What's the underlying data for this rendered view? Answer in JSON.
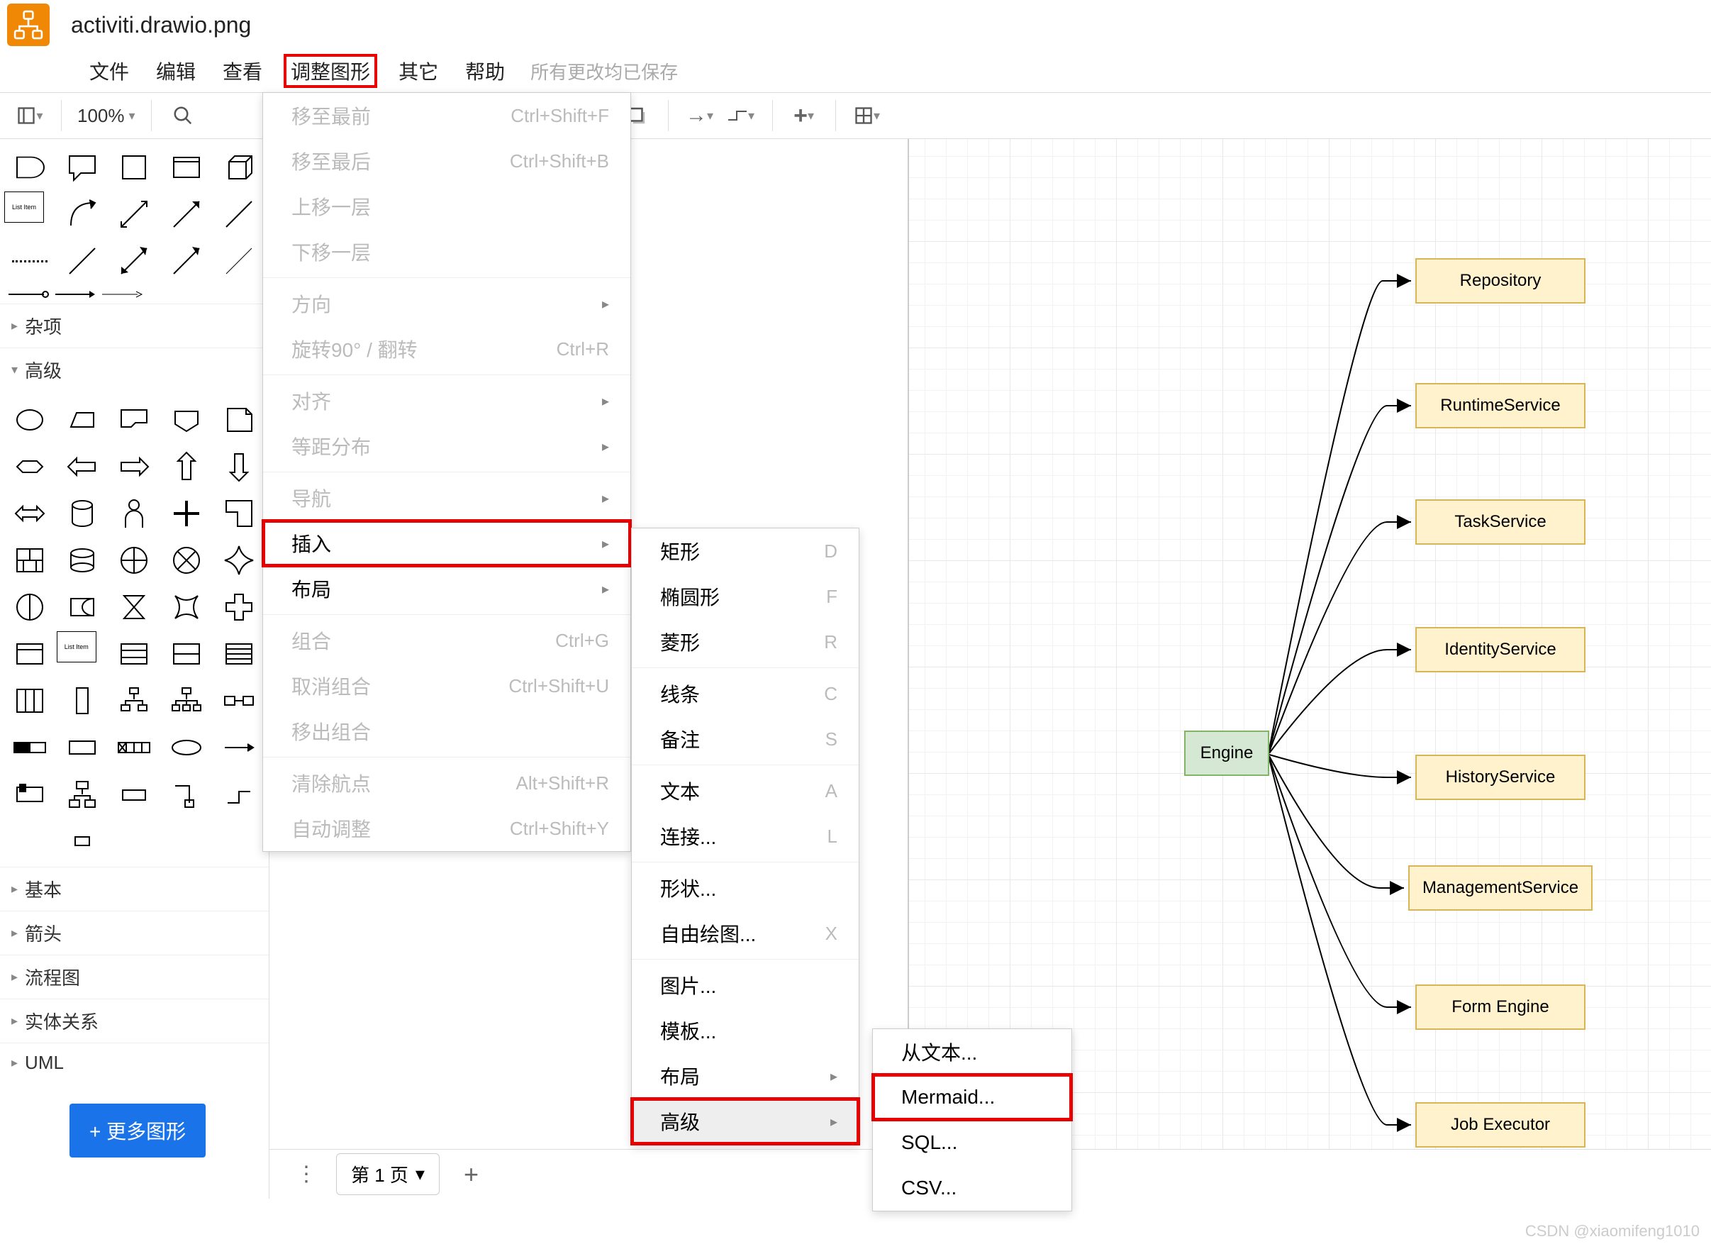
{
  "file": {
    "name": "activiti.drawio.png"
  },
  "menubar": {
    "items": [
      "文件",
      "编辑",
      "查看",
      "调整图形",
      "其它",
      "帮助"
    ],
    "saved": "所有更改均已保存"
  },
  "toolbar": {
    "zoom": "100%"
  },
  "sidebar": {
    "cats": [
      "杂项",
      "高级",
      "基本",
      "箭头",
      "流程图",
      "实体关系",
      "UML"
    ],
    "more": "+ 更多图形",
    "list_label": "List Item"
  },
  "dropdown1": {
    "toFront": {
      "label": "移至最前",
      "sc": "Ctrl+Shift+F"
    },
    "toBack": {
      "label": "移至最后",
      "sc": "Ctrl+Shift+B"
    },
    "up": {
      "label": "上移一层",
      "sc": ""
    },
    "down": {
      "label": "下移一层",
      "sc": ""
    },
    "direction": {
      "label": "方向"
    },
    "rotate": {
      "label": "旋转90° / 翻转",
      "sc": "Ctrl+R"
    },
    "align": {
      "label": "对齐"
    },
    "distribute": {
      "label": "等距分布"
    },
    "nav": {
      "label": "导航"
    },
    "insert": {
      "label": "插入"
    },
    "layout": {
      "label": "布局"
    },
    "group": {
      "label": "组合",
      "sc": "Ctrl+G"
    },
    "ungroup": {
      "label": "取消组合",
      "sc": "Ctrl+Shift+U"
    },
    "moveout": {
      "label": "移出组合"
    },
    "clearwp": {
      "label": "清除航点",
      "sc": "Alt+Shift+R"
    },
    "autofit": {
      "label": "自动调整",
      "sc": "Ctrl+Shift+Y"
    }
  },
  "dropdown2": {
    "rect": {
      "label": "矩形",
      "sc": "D"
    },
    "ellipse": {
      "label": "椭圆形",
      "sc": "F"
    },
    "rhombus": {
      "label": "菱形",
      "sc": "R"
    },
    "line": {
      "label": "线条",
      "sc": "C"
    },
    "note": {
      "label": "备注",
      "sc": "S"
    },
    "text": {
      "label": "文本",
      "sc": "A"
    },
    "connect": {
      "label": "连接...",
      "sc": "L"
    },
    "shape": {
      "label": "形状..."
    },
    "freehand": {
      "label": "自由绘图...",
      "sc": "X"
    },
    "image": {
      "label": "图片..."
    },
    "template": {
      "label": "模板..."
    },
    "layout": {
      "label": "布局"
    },
    "advanced": {
      "label": "高级"
    }
  },
  "dropdown3": {
    "fromtext": {
      "label": "从文本..."
    },
    "mermaid": {
      "label": "Mermaid..."
    },
    "sql": {
      "label": "SQL..."
    },
    "csv": {
      "label": "CSV..."
    }
  },
  "diagram": {
    "engine": "Engine",
    "services": [
      "Repository",
      "RuntimeService",
      "TaskService",
      "IdentityService",
      "HistoryService",
      "ManagementService",
      "Form Engine",
      "Job Executor"
    ]
  },
  "footer": {
    "page": "第 1 页"
  },
  "watermark": "CSDN @xiaomifeng1010"
}
